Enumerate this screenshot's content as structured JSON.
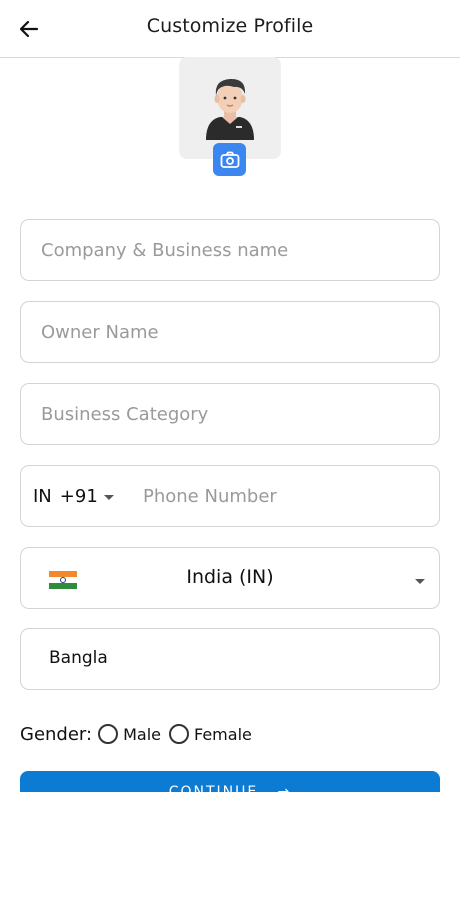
{
  "header": {
    "title": "Customize Profile",
    "back_icon": "arrow-left-icon"
  },
  "avatar": {
    "icon": "user-avatar-icon",
    "camera_icon": "camera-icon",
    "camera_color": "#3b86f0"
  },
  "form": {
    "company_placeholder": "Company & Business name",
    "owner_placeholder": "Owner Name",
    "category_placeholder": "Business Category",
    "phone": {
      "country_code_label": "IN",
      "dial_code": "+91",
      "placeholder": "Phone Number"
    },
    "country": {
      "flag_icon": "india-flag-icon",
      "value": "India (IN)"
    },
    "language": {
      "value": "Bangla"
    },
    "gender": {
      "label": "Gender:",
      "options": [
        "Male",
        "Female"
      ]
    }
  },
  "continue_button": {
    "label": "CONTINUE",
    "color": "#0b7bd4"
  }
}
